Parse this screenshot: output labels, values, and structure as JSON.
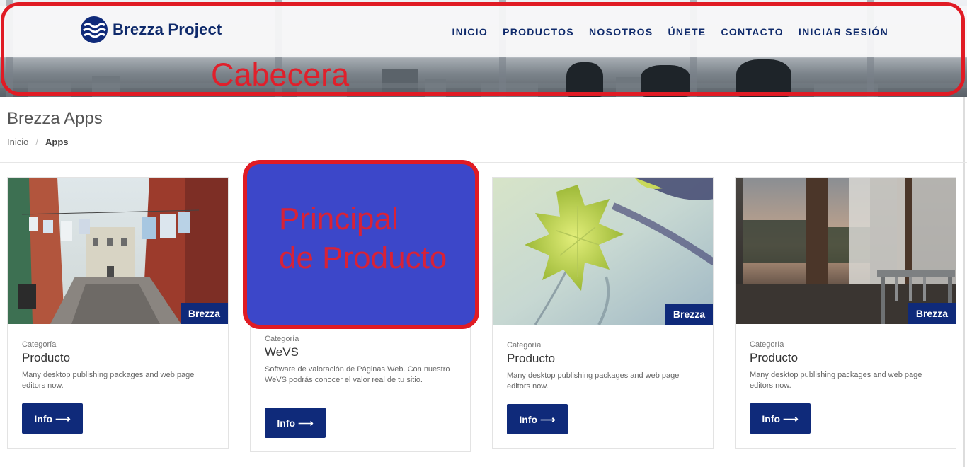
{
  "brand": {
    "name": "Brezza Project",
    "primary": "#0f2a7a"
  },
  "nav": {
    "items": [
      "INICIO",
      "PRODUCTOS",
      "NOSOTROS",
      "ÚNETE",
      "CONTACTO",
      "INICIAR SESIÓN"
    ]
  },
  "annotations": {
    "header": "Cabecera",
    "main_line1": "Principal",
    "main_line2": "de Producto",
    "color": "#e01b24"
  },
  "page": {
    "title": "Brezza Apps",
    "breadcrumb": {
      "home": "Inicio",
      "separator": "/",
      "current": "Apps"
    }
  },
  "cards": [
    {
      "badge": "Brezza",
      "category": "Categoría",
      "title": "Producto",
      "description": "Many desktop publishing packages and web page editors now.",
      "button": "Info",
      "image": "venice-street-photo"
    },
    {
      "badge": "",
      "category": "Categoría",
      "title": "WeVS",
      "description": "Software de valoración de Páginas Web. Con nuestro WeVS podrás conocer el valor real de tu sitio.",
      "button": "Info",
      "image": "annotation-placeholder"
    },
    {
      "badge": "Brezza",
      "category": "Categoría",
      "title": "Producto",
      "description": "Many desktop publishing packages and web page editors now.",
      "button": "Info",
      "image": "leaf-photo"
    },
    {
      "badge": "Brezza",
      "category": "Categoría",
      "title": "Producto",
      "description": "Many desktop publishing packages and web page editors now.",
      "button": "Info",
      "image": "window-chair-photo"
    }
  ],
  "icons": {
    "logo": "waves-logo-icon",
    "arrow": "arrow-right-icon"
  }
}
